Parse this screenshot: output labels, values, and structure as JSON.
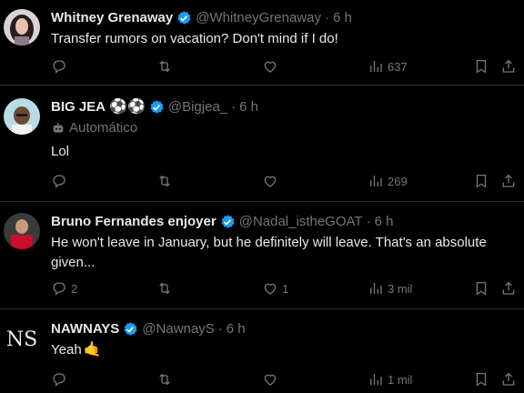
{
  "tweets": [
    {
      "name": "Whitney Grenaway",
      "handle": "@WhitneyGrenaway",
      "sep": "·",
      "time": "6 h",
      "text": "Transfer rumors on vacation? Don't mind if I do!",
      "replies": "",
      "likes": "",
      "views": "637"
    },
    {
      "name": "BIG JEA",
      "name_emojis": "⚽⚽",
      "handle": "@Bigjea_",
      "sep": "·",
      "time": "6 h",
      "auto_label": "Automático",
      "text": "Lol",
      "replies": "",
      "likes": "",
      "views": "269"
    },
    {
      "name": "Bruno Fernandes enjoyer",
      "handle": "@Nadal_istheGOAT",
      "sep": "·",
      "time": "6 h",
      "text": "He won't leave in January, but he definitely will leave. That's an absolute given...",
      "replies": "2",
      "likes": "1",
      "views": "3 mil"
    },
    {
      "name": "NAWNAYS",
      "handle": "@NawnayS",
      "sep": "·",
      "time": "6 h",
      "text": "Yeah",
      "text_emoji": "🤙",
      "replies": "",
      "likes": "",
      "views": "1 mil"
    }
  ],
  "icons": {
    "reply": "reply-icon",
    "retweet": "retweet-icon",
    "like": "heart-icon",
    "views": "views-icon",
    "bookmark": "bookmark-icon",
    "share": "share-icon"
  },
  "colors": {
    "background": "#000000",
    "verified": "#1d9bf0",
    "muted": "#71767b",
    "divider": "#2f3336"
  }
}
